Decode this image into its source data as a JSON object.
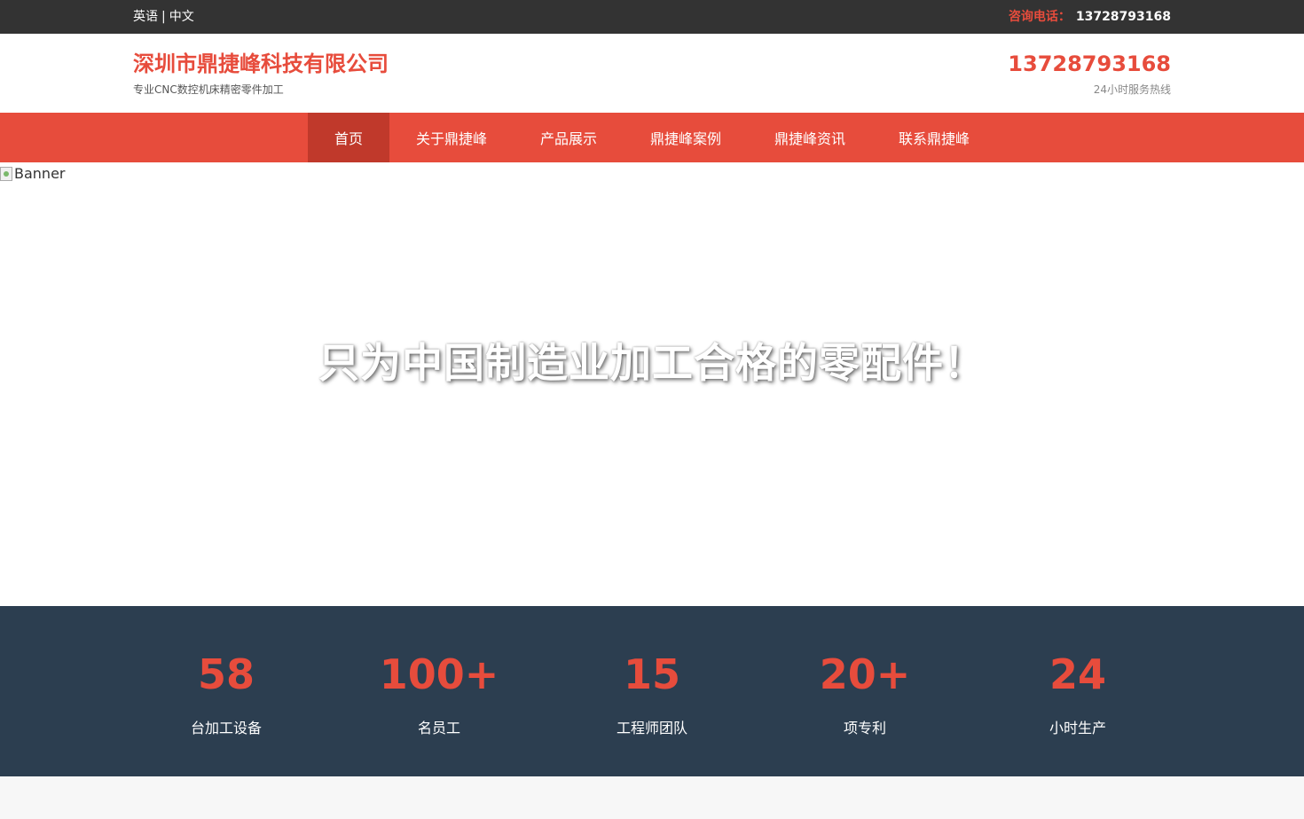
{
  "topbar": {
    "lang_en": "英语",
    "lang_sep": "|",
    "lang_zh": "中文",
    "consult_label": "咨询电话：",
    "consult_phone": "13728793168"
  },
  "header": {
    "company_name": "深圳市鼎捷峰科技有限公司",
    "slogan": "专业CNC数控机床精密零件加工",
    "hotline": "13728793168",
    "hotline_sub": "24小时服务热线"
  },
  "nav": {
    "items": [
      {
        "label": "首页",
        "active": true
      },
      {
        "label": "关于鼎捷峰",
        "active": false
      },
      {
        "label": "产品展示",
        "active": false
      },
      {
        "label": "鼎捷峰案例",
        "active": false
      },
      {
        "label": "鼎捷峰资讯",
        "active": false
      },
      {
        "label": "联系鼎捷峰",
        "active": false
      }
    ]
  },
  "banner": {
    "alt": "Banner",
    "headline": "只为中国制造业加工合格的零配件！"
  },
  "stats": [
    {
      "number": "58",
      "label": "台加工设备"
    },
    {
      "number": "100+",
      "label": "名员工"
    },
    {
      "number": "15",
      "label": "工程师团队"
    },
    {
      "number": "20+",
      "label": "项专利"
    },
    {
      "number": "24",
      "label": "小时生产"
    }
  ],
  "colors": {
    "accent": "#e74c3c",
    "accent_dark": "#c0392b",
    "topbar_bg": "#333333",
    "stats_bg": "#2c3e50"
  }
}
